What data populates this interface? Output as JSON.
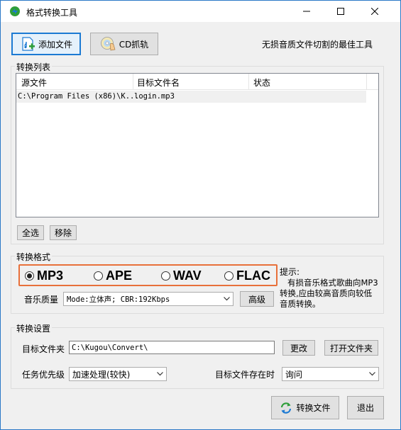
{
  "window": {
    "title": "格式转换工具",
    "controls": {
      "minimize": "minimize",
      "maximize": "maximize",
      "close": "close"
    }
  },
  "toolbar": {
    "add_file_label": "添加文件",
    "cd_rip_label": "CD抓轨",
    "slogan": "无损音质文件切割的最佳工具"
  },
  "list": {
    "group_label": "转换列表",
    "columns": [
      "源文件",
      "目标文件名",
      "状态"
    ],
    "rows": [
      {
        "source": "C:\\Program Files (x86)\\K...",
        "target": "login.mp3",
        "status": ""
      }
    ],
    "select_all_label": "全选",
    "remove_label": "移除"
  },
  "format": {
    "group_label": "转换格式",
    "options": [
      {
        "label": "MP3",
        "selected": true
      },
      {
        "label": "APE",
        "selected": false
      },
      {
        "label": "WAV",
        "selected": false
      },
      {
        "label": "FLAC",
        "selected": false
      }
    ],
    "highlight_color": "#e8703a",
    "hint_title": "提示:",
    "hint_lines": [
      "有损音乐格式歌曲向MP3",
      "转换,应由较高音质向较低",
      "音质转换。"
    ],
    "quality_label": "音乐质量",
    "quality_value": "Mode:立体声; CBR:192Kbps",
    "advanced_label": "高级"
  },
  "settings": {
    "group_label": "转换设置",
    "target_folder_label": "目标文件夹",
    "target_folder_value": "C:\\Kugou\\Convert\\",
    "change_label": "更改",
    "open_folder_label": "打开文件夹",
    "priority_label": "任务优先级",
    "priority_value": "加速处理(较快)",
    "exists_label": "目标文件存在时",
    "exists_value": "询问"
  },
  "footer": {
    "convert_label": "转换文件",
    "exit_label": "退出"
  },
  "colors": {
    "window_border": "#2b79c7",
    "accent_green": "#2e9e3a",
    "accent_blue": "#1c7ad3"
  }
}
